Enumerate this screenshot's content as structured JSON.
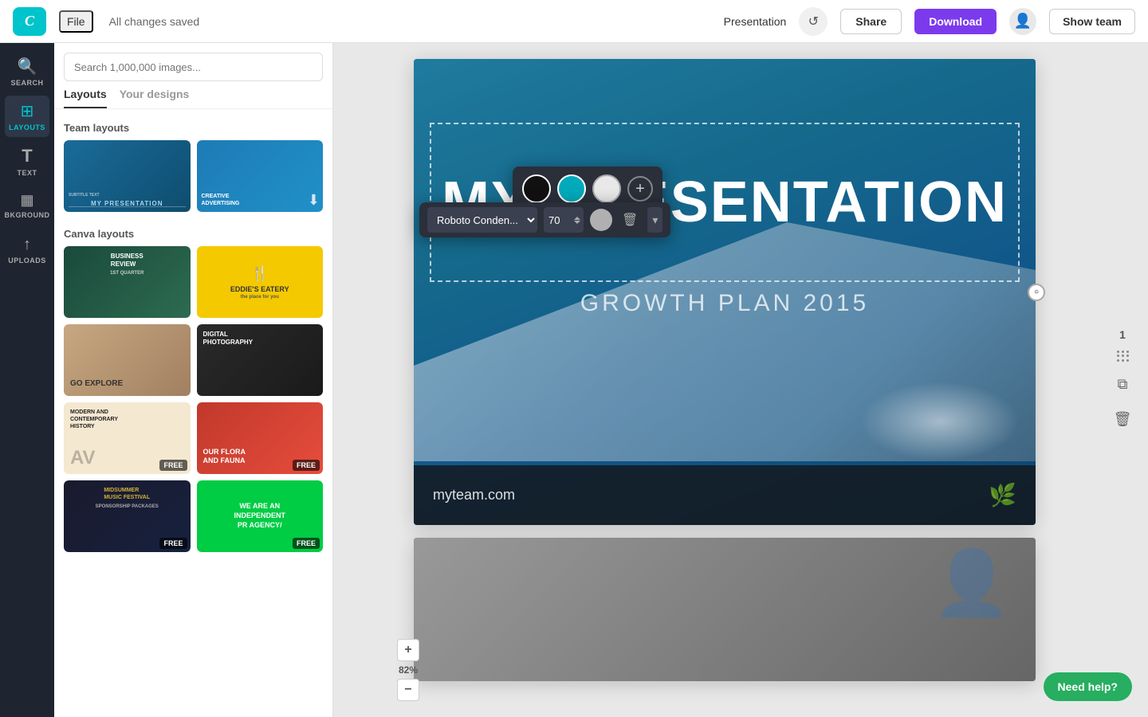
{
  "header": {
    "logo_text": "C",
    "file_label": "File",
    "changes_saved": "All changes saved",
    "presentation_label": "Presentation",
    "share_label": "Share",
    "download_label": "Download",
    "show_team_label": "Show team"
  },
  "sidebar": {
    "items": [
      {
        "icon": "🔍",
        "label": "SEARCH",
        "active": false
      },
      {
        "icon": "☰",
        "label": "LAYOUTS",
        "active": true
      },
      {
        "icon": "T",
        "label": "TEXT",
        "active": false
      },
      {
        "icon": "▦",
        "label": "BKGROUND",
        "active": false
      },
      {
        "icon": "↑",
        "label": "UPLOADS",
        "active": false
      }
    ]
  },
  "panel": {
    "search_placeholder": "Search 1,000,000 images...",
    "tabs": [
      "Layouts",
      "Your designs"
    ],
    "active_tab": "Layouts",
    "team_layouts_title": "Team layouts",
    "canva_layouts_title": "Canva layouts",
    "team_cards": [
      {
        "title": "MY PRESENTATION",
        "style": "my-presentation"
      },
      {
        "title": "CREATIVE ADVERTISING",
        "style": "creative-advertising"
      }
    ],
    "canva_cards": [
      {
        "title": "BUSINESS REVIEW",
        "style": "business-review",
        "badge": ""
      },
      {
        "title": "EDDIE'S EATERY",
        "style": "eddies",
        "badge": ""
      },
      {
        "title": "GO EXPLORE",
        "style": "go-explore",
        "badge": ""
      },
      {
        "title": "DIGITAL PHOTOGRAPHY",
        "style": "digital-photography",
        "badge": ""
      },
      {
        "title": "MODERN AND CONTEMPORARY HISTORY",
        "style": "modern-contemporary",
        "badge": "FREE"
      },
      {
        "title": "OUR FLORA AND FAUNA",
        "style": "flora-fauna",
        "badge": "FREE"
      },
      {
        "title": "MIDSUMMER SPONSORSHIP PACKAGES",
        "style": "midsummer",
        "badge": "FREE"
      },
      {
        "title": "WE ARE AN INDEPENDENT PR AGENCY/",
        "style": "independent-pr",
        "badge": "FREE"
      }
    ]
  },
  "color_picker": {
    "colors": [
      "#111111",
      "#00aabb",
      "#e8e8e8"
    ],
    "add_label": "+"
  },
  "font_toolbar": {
    "font_name": "Roboto Conden...",
    "font_size": "70",
    "color": "#b0b0b0"
  },
  "slide": {
    "title": "MY PRESENTATION",
    "subtitle": "GROWTH PLAN 2015",
    "website": "myteam.com"
  },
  "right_sidebar": {
    "page_num": "1"
  },
  "zoom": {
    "level": "82%",
    "plus_label": "+",
    "minus_label": "−"
  },
  "need_help": {
    "label": "Need help?"
  }
}
